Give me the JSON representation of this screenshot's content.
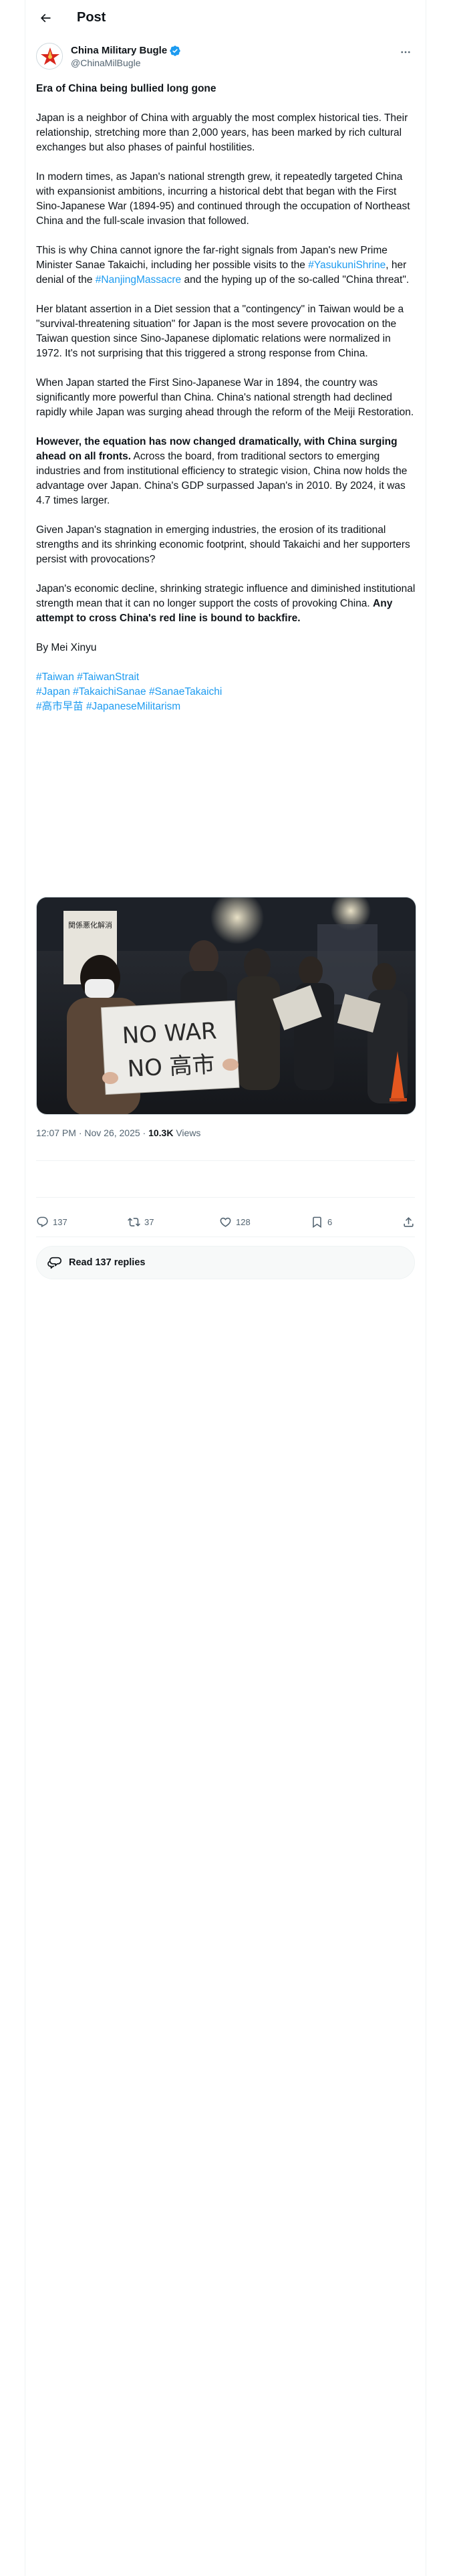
{
  "header": {
    "title": "Post"
  },
  "author": {
    "display_name": "China Military Bugle",
    "handle": "@ChinaMilBugle"
  },
  "post": {
    "title": "Era of China being bullied long gone",
    "p1": "Japan is a neighbor of China with arguably the most complex historical ties. Their relationship, stretching more than 2,000 years, has been marked by rich cultural exchanges but also phases of painful hostilities.",
    "p2": "In modern times, as Japan's national strength grew, it repeatedly targeted China with expansionist ambitions, incurring a historical debt that began with the First Sino-Japanese War (1894-95) and continued through the occupation of Northeast China and the full-scale invasion that followed.",
    "p3_a": "This is why China cannot ignore the far-right signals from Japan's new Prime Minister Sanae Takaichi, including her possible visits to the ",
    "p3_tag1": "#YasukuniShrine",
    "p3_b": ", her denial of the ",
    "p3_tag2": "#NanjingMassacre",
    "p3_c": " and the hyping up of the so-called \"China threat\".",
    "p4": "Her blatant assertion in a Diet session that a \"contingency\" in Taiwan would be a \"survival-threatening situation\" for Japan is the most severe provocation on the Taiwan question since Sino-Japanese diplomatic relations were normalized in 1972. It's not surprising that this triggered a strong response from China.",
    "p5": "When Japan started the First Sino-Japanese War in 1894, the country was significantly more powerful than China. China's national strength had declined rapidly while Japan was surging ahead through the reform of the Meiji Restoration.",
    "p6_bold": "However, the equation has now changed dramatically, with China surging ahead on all fronts.",
    "p6_rest": " Across the board, from traditional sectors to emerging industries and from institutional efficiency to strategic vision, China now holds the advantage over Japan. China's GDP surpassed Japan's in 2010. By 2024, it was 4.7 times larger.",
    "p7": "Given Japan's stagnation in emerging industries, the erosion of its traditional strengths and its shrinking economic footprint, should Takaichi and her supporters persist with provocations?",
    "p8_a": "Japan's economic decline, shrinking strategic influence and diminished institutional strength mean that it can no longer support the costs of provoking China. ",
    "p8_bold": "Any attempt to cross China's red line is bound to backfire.",
    "byline": "By Mei Xinyu",
    "tags_line1": [
      "#Taiwan",
      "#TaiwanStrait"
    ],
    "tags_line2": [
      "#Japan",
      "#TakaichiSanae",
      "#SanaeTakaichi"
    ],
    "tags_line3": [
      "#高市早苗",
      "#JapaneseMilitarism"
    ]
  },
  "photo": {
    "sign_line1": "NO WAR",
    "sign_line2": "NO 高市",
    "banner_text": "関係悪化解消"
  },
  "meta": {
    "time": "12:07 PM · Nov 26, 2025 · ",
    "views_count": "10.3K",
    "views_label": " Views"
  },
  "actions": {
    "replies": "137",
    "reposts": "37",
    "likes": "128",
    "bookmarks": "6"
  },
  "read_replies": "Read 137 replies",
  "colors": {
    "accent": "#1d9bf0",
    "text": "#0f1419",
    "muted": "#536471",
    "border": "#eff3f4"
  }
}
